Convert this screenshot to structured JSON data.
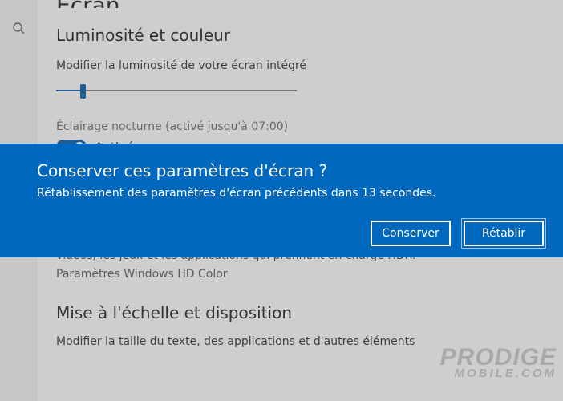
{
  "page": {
    "title": "Écran"
  },
  "brightness": {
    "heading": "Luminosité et couleur",
    "slider_label": "Modifier la luminosité de votre écran intégré",
    "nightlight": "Éclairage nocturne (activé jusqu'à 07:00)",
    "toggle_state": "Activé"
  },
  "hdr": {
    "desc_line": "vidéos, les jeux et les applications qui prennent en charge HDR.",
    "link": "Paramètres Windows HD Color"
  },
  "scale": {
    "heading": "Mise à l'échelle et disposition",
    "size_label": "Modifier la taille du texte, des applications et d'autres éléments"
  },
  "dialog": {
    "title": "Conserver ces paramètres d'écran ?",
    "message": "Rétablissement des paramètres d'écran précédents dans 13 secondes.",
    "keep": "Conserver",
    "revert": "Rétablir"
  },
  "watermark": {
    "l1": "PRODIGE",
    "l2": "MOBILE.COM"
  }
}
